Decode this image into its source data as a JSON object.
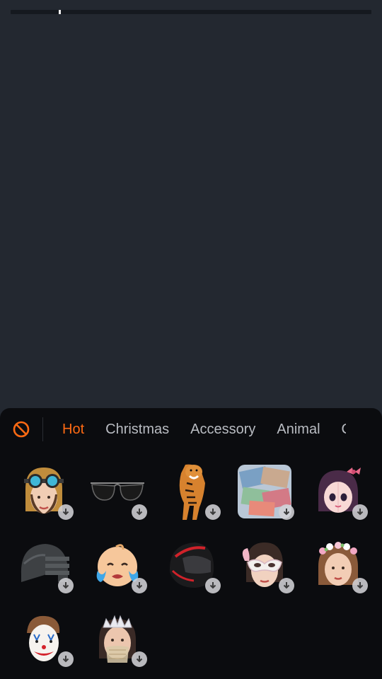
{
  "colors": {
    "background": "#232830",
    "sheet": "#0b0c0f",
    "accent": "#ff6a13",
    "tab_text": "#b9bcc2"
  },
  "progress": {
    "marker_fraction": 0.13
  },
  "toolbar": {
    "none_icon": "no-effect-icon"
  },
  "tabs": [
    {
      "label": "Hot",
      "active": true
    },
    {
      "label": "Christmas",
      "active": false
    },
    {
      "label": "Accessory",
      "active": false
    },
    {
      "label": "Animal",
      "active": false
    },
    {
      "label": "C",
      "active": false
    }
  ],
  "stickers": [
    {
      "name": "aviator-goggles-cap",
      "downloadable": true
    },
    {
      "name": "black-sunglasses",
      "downloadable": true
    },
    {
      "name": "tiger",
      "downloadable": true
    },
    {
      "name": "money-bills",
      "downloadable": true
    },
    {
      "name": "anime-girl-bow",
      "downloadable": true
    },
    {
      "name": "military-helmet",
      "downloadable": true
    },
    {
      "name": "crying-baby-emoji",
      "downloadable": true
    },
    {
      "name": "motorcycle-helmet",
      "downloadable": true
    },
    {
      "name": "masquerade-mask",
      "downloadable": true
    },
    {
      "name": "flower-crown",
      "downloadable": true
    },
    {
      "name": "joker-face",
      "downloadable": true
    },
    {
      "name": "tiara-veil",
      "downloadable": true
    }
  ]
}
